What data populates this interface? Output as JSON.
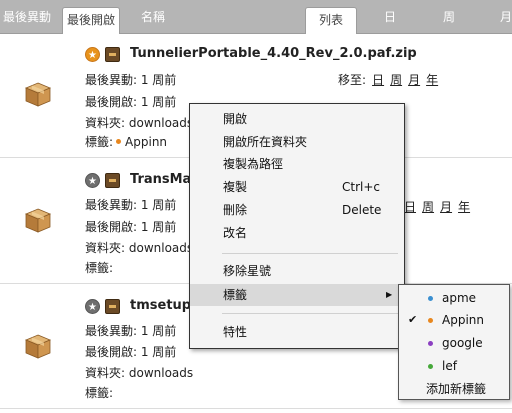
{
  "topbar": {
    "sort_recent": "最後異動",
    "sort_opened": "最後開啟",
    "sort_name": "名稱",
    "view_list": "列表",
    "view_day": "日",
    "view_week": "周",
    "view_month": "月"
  },
  "rows": [
    {
      "file_name": "TunnelierPortable_4.40_Rev_2.0.paf.zip",
      "starred": true,
      "modified_label": "最後異動: 1 周前",
      "opened_label": "最後開啟: 1 周前",
      "folder_label": "資料夾: downloads",
      "tags_label": "標籤:",
      "tag": "Appinn",
      "tag_color": "#e8871e",
      "move_label": "移至:",
      "move_day": "日",
      "move_week": "周",
      "move_month": "月",
      "move_year": "年"
    },
    {
      "file_name": "TransMac",
      "starred": false,
      "modified_label": "最後異動: 1 周前",
      "opened_label": "最後開啟: 1 周前",
      "folder_label": "資料夾: downloads",
      "tags_label": "標籤:",
      "move_day": "日",
      "move_week": "周",
      "move_month": "月",
      "move_year": "年"
    },
    {
      "file_name": "tmsetup",
      "starred": false,
      "modified_label": "最後異動: 1 周前",
      "opened_label": "最後開啟: 1 周前",
      "folder_label": "資料夾: downloads",
      "tags_label": "標籤:"
    }
  ],
  "context_menu": {
    "open": "開啟",
    "open_folder": "開啟所在資料夾",
    "copy_path": "複製為路徑",
    "copy": "複製",
    "copy_shortcut": "Ctrl+c",
    "delete": "刪除",
    "delete_shortcut": "Delete",
    "rename": "改名",
    "remove_star": "移除星號",
    "tags": "標籤",
    "properties": "特性"
  },
  "tags_submenu": {
    "items": [
      {
        "label": "apme",
        "color": "#3a8fd0",
        "checked": false
      },
      {
        "label": "Appinn",
        "color": "#e8871e",
        "checked": true
      },
      {
        "label": "google",
        "color": "#8b3fc1",
        "checked": false
      },
      {
        "label": "lef",
        "color": "#46a83a",
        "checked": false
      }
    ],
    "add_new": "添加新標籤",
    "check_glyph": "✔"
  },
  "colors": {
    "topbar": "#b5b5b5",
    "star_gold": "#e8931c",
    "star_grey": "#6f6f6f",
    "menu_bg": "#f4f4f4",
    "menu_highlight": "#d9d9d9"
  },
  "icons": {
    "star": "star-icon",
    "zip": "zip-file-icon",
    "package": "package-icon",
    "submenu_arrow": "chevron-right-icon"
  }
}
